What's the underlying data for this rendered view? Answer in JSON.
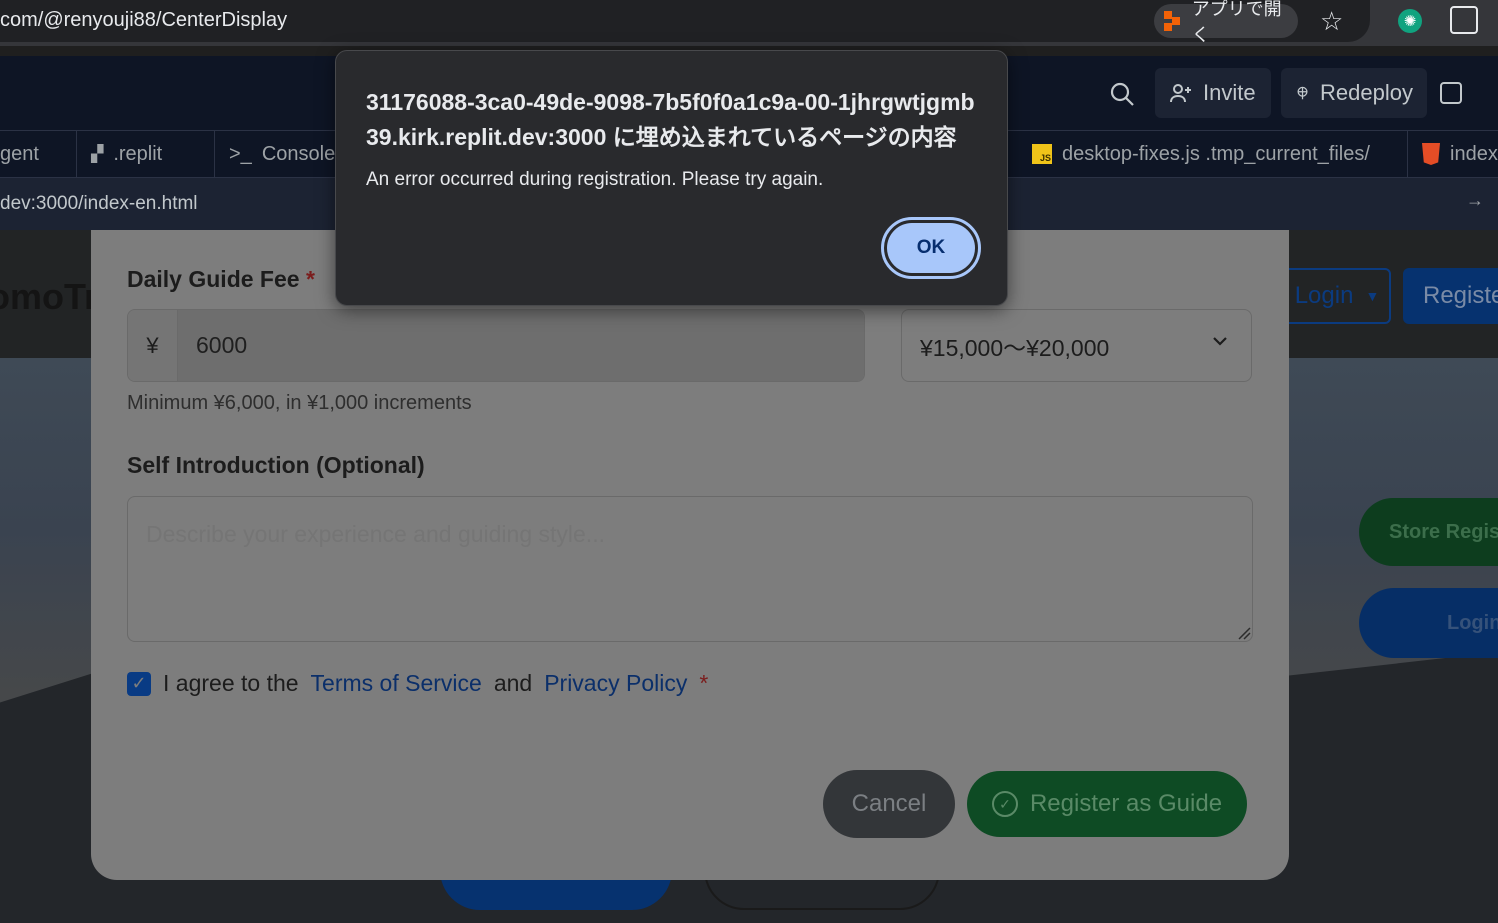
{
  "browser": {
    "url": "com/@renyouji88/CenterDisplay",
    "open_in_app": "アプリで開く",
    "icons": [
      "star-icon",
      "chatgpt-extension-icon",
      "extensions-icon"
    ]
  },
  "workspace": {
    "invite_label": "Invite",
    "redeploy_label": "Redeploy",
    "tabs": [
      {
        "label": "gent",
        "icon": "agent-icon"
      },
      {
        "label": ".replit",
        "icon": "config-icon"
      },
      {
        "label": "Console",
        "icon": "terminal-icon"
      },
      {
        "label": "desktop-fixes.js .tmp_current_files/",
        "icon": "js-file-icon"
      },
      {
        "label": "index.",
        "icon": "html-file-icon"
      }
    ],
    "webview_url": "dev:3000/index-en.html"
  },
  "background_page": {
    "brand": "omoTr",
    "login_label": "Login",
    "register_label": "Registe",
    "store_register_label": "Store Regis",
    "login2_label": "Login"
  },
  "form": {
    "fee_label": "Daily Guide Fee",
    "required_mark": "*",
    "currency_symbol": "¥",
    "fee_value": "6000",
    "price_range": "¥15,000〜¥20,000",
    "fee_help": "Minimum ¥6,000, in ¥1,000 increments",
    "intro_label": "Self Introduction (Optional)",
    "intro_placeholder": "Describe your experience and guiding style...",
    "agree_prefix": "I agree to the",
    "terms_link": "Terms of Service",
    "agree_and": "and",
    "privacy_link": "Privacy Policy",
    "agreed": true,
    "cancel_label": "Cancel",
    "register_label": "Register as Guide"
  },
  "alert": {
    "title": "31176088-3ca0-49de-9098-7b5f0f0a1c9a-00-1jhrgwtjgmb39.kirk.replit.dev:3000 に埋め込まれているページの内容",
    "message": "An error occurred during registration. Please try again.",
    "ok_label": "OK"
  },
  "colors": {
    "alert_button": "#a8c7fa",
    "register_button": "#0e4b24",
    "checkbox": "#093b84"
  }
}
